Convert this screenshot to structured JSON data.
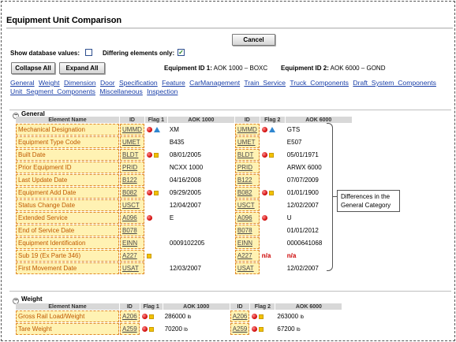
{
  "title": "Equipment Unit Comparison",
  "buttons": {
    "cancel": "Cancel",
    "collapse_all": "Collapse All",
    "expand_all": "Expand All"
  },
  "options": {
    "show_db_label": "Show database values:",
    "show_db_checked": false,
    "differing_label": "Differing elements only:",
    "differing_checked": true,
    "check_glyph": "✓"
  },
  "equipment": {
    "id1_label": "Equipment ID 1:",
    "id1_value": "AOK 1000 – BOXC",
    "id2_label": "Equipment ID 2:",
    "id2_value": "AOK 6000 – GOND"
  },
  "category_links": [
    "General",
    "Weight",
    "Dimension",
    "Door",
    "Specification",
    "Feature",
    "CarManagement",
    "Train_Service",
    "Truck_Components",
    "Draft_System_Components",
    "Unit_Segment_Components",
    "Miscellaneous",
    "Inspection"
  ],
  "columns": {
    "name": "Element Name",
    "id": "ID",
    "flag1": "Flag 1",
    "aok1": "AOK 1000",
    "id2": "ID",
    "flag2": "Flag 2",
    "aok2": "AOK 6000"
  },
  "sections": {
    "general": {
      "toggle": "−",
      "label": "General",
      "rows": [
        {
          "name": "Mechanical Designation",
          "id": "UMMD",
          "flag1": [
            "red",
            "blue"
          ],
          "v1": "XM",
          "id2": "UMMD",
          "flag2": [
            "red",
            "blue"
          ],
          "v2": "GTS"
        },
        {
          "name": "Equipment Type Code",
          "id": "UMET",
          "flag1": [],
          "v1": "B435",
          "id2": "UMET",
          "flag2": [],
          "v2": "E507"
        },
        {
          "name": "Built Date",
          "id": "BLDT",
          "flag1": [
            "red",
            "yellow"
          ],
          "v1": "08/01/2005",
          "id2": "BLDT",
          "flag2": [
            "red",
            "yellow"
          ],
          "v2": "05/01/1971"
        },
        {
          "name": "Prior Equipment ID",
          "id": "PRID",
          "flag1": [],
          "v1": "NCXX 1000",
          "id2": "PRID",
          "flag2": [],
          "v2": "ARWX 6000"
        },
        {
          "name": "Last Update Date",
          "id": "B122",
          "flag1": [],
          "v1": "04/16/2008",
          "id2": "B122",
          "flag2": [],
          "v2": "07/07/2009"
        },
        {
          "name": "Equipment Add Date",
          "id": "B082",
          "flag1": [
            "red",
            "yellow"
          ],
          "v1": "09/29/2005",
          "id2": "B082",
          "flag2": [
            "red",
            "yellow"
          ],
          "v2": "01/01/1900"
        },
        {
          "name": "Status Change Date",
          "id": "USCT",
          "flag1": [],
          "v1": "12/04/2007",
          "id2": "USCT",
          "flag2": [],
          "v2": "12/02/2007"
        },
        {
          "name": "Extended Service",
          "id": "A096",
          "flag1": [
            "red"
          ],
          "v1": "E",
          "id2": "A096",
          "flag2": [
            "red"
          ],
          "v2": "U"
        },
        {
          "name": "End of Service Date",
          "id": "B078",
          "flag1": [],
          "v1": "",
          "id2": "B078",
          "flag2": [],
          "v2": "01/01/2012"
        },
        {
          "name": "Equipment Identification",
          "id": "EINN",
          "flag1": [],
          "v1": "0009102205",
          "id2": "EINN",
          "flag2": [],
          "v2": "0000641068"
        },
        {
          "name": "Sub 19 (Ex Parte 346)",
          "id": "A227",
          "flag1": [
            "yellow"
          ],
          "v1": "",
          "id2": "A227",
          "flag2_text": "n/a",
          "flag2": [],
          "v2": "n/a",
          "v2_na": true
        },
        {
          "name": "First Movement Date",
          "id": "USAT",
          "flag1": [],
          "v1": "12/03/2007",
          "id2": "USAT",
          "flag2": [],
          "v2": "12/02/2007"
        }
      ]
    },
    "weight": {
      "toggle": "−",
      "label": "Weight",
      "rows": [
        {
          "name": "Gross Rail Load/Weight",
          "id": "A206",
          "flag1": [
            "red",
            "yellow"
          ],
          "v1": "286000",
          "u1": "lb",
          "id2": "A206",
          "flag2": [
            "red",
            "yellow"
          ],
          "v2": "263000",
          "u2": "lb"
        },
        {
          "name": "Tare Weight",
          "id": "A259",
          "flag1": [
            "red",
            "yellow"
          ],
          "v1": "70200",
          "u1": "lb",
          "id2": "A259",
          "flag2": [
            "red",
            "yellow"
          ],
          "v2": "67200",
          "u2": "lb"
        }
      ]
    }
  },
  "callout": "Differences in the General Category",
  "colors": {
    "link": "#1a3fa8",
    "name_text": "#c05a00",
    "cell_bg": "#fff2b3",
    "cell_border": "#e08a2a",
    "flag_red": "#cc0000",
    "flag_yellow": "#f2c200",
    "flag_blue": "#2f86d0",
    "header_bg": "#d8d8d8"
  }
}
